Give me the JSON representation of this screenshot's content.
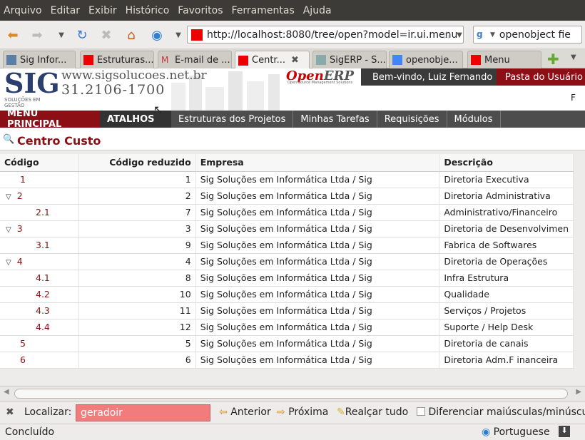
{
  "menubar": [
    "Arquivo",
    "Editar",
    "Exibir",
    "Histórico",
    "Favoritos",
    "Ferramentas",
    "Ajuda"
  ],
  "url": "http://localhost:8080/tree/open?model=ir.ui.menu",
  "search": "openobject fie",
  "tabs": [
    "Sig Infor...",
    "Estruturas...",
    "E-mail de ...",
    "Centr...",
    "SigERP - S...",
    "openobje...",
    "Menu"
  ],
  "header": {
    "site": "www.sigsolucoes.net.br",
    "phone": "31.2106-1700",
    "logo_big": "SIG",
    "logo_small": "SOLUÇÕES EM GESTÃO",
    "oerp_open": "Open",
    "oerp_erp": "ERP",
    "oerp_sub": "Open Source Management Solutions",
    "welcome": "Bem-vindo, Luiz Fernando",
    "user_panel": "Pasta do Usuário",
    "right_char": "F"
  },
  "menu": {
    "main": "MENU PRINCIPAL",
    "shortcuts": "ATALHOS",
    "items": [
      "Estruturas dos Projetos",
      "Minhas Tarefas",
      "Requisições",
      "Módulos"
    ]
  },
  "page_title": "Centro Custo",
  "table": {
    "headers": [
      "Código",
      "Código reduzido",
      "Empresa",
      "Descrição"
    ],
    "rows": [
      {
        "code": "1",
        "red": "1",
        "emp": "Sig Soluções em Informática Ltda / Sig",
        "desc": "Diretoria Executiva",
        "exp": false,
        "ind": 1
      },
      {
        "code": "2",
        "red": "2",
        "emp": "Sig Soluções em Informática Ltda / Sig",
        "desc": "Diretoria Administrativa",
        "exp": true,
        "ind": 1
      },
      {
        "code": "2.1",
        "red": "7",
        "emp": "Sig Soluções em Informática Ltda / Sig",
        "desc": "Administrativo/Financeiro",
        "exp": false,
        "ind": 2
      },
      {
        "code": "3",
        "red": "3",
        "emp": "Sig Soluções em Informática Ltda / Sig",
        "desc": "Diretoria de Desenvolvimen",
        "exp": true,
        "ind": 1
      },
      {
        "code": "3.1",
        "red": "9",
        "emp": "Sig Soluções em Informática Ltda / Sig",
        "desc": "Fabrica de Softwares",
        "exp": false,
        "ind": 2
      },
      {
        "code": "4",
        "red": "4",
        "emp": "Sig Soluções em Informática Ltda / Sig",
        "desc": "Diretoria de Operações",
        "exp": true,
        "ind": 1
      },
      {
        "code": "4.1",
        "red": "8",
        "emp": "Sig Soluções em Informática Ltda / Sig",
        "desc": "Infra Estrutura",
        "exp": false,
        "ind": 2
      },
      {
        "code": "4.2",
        "red": "10",
        "emp": "Sig Soluções em Informática Ltda / Sig",
        "desc": "Qualidade",
        "exp": false,
        "ind": 2
      },
      {
        "code": "4.3",
        "red": "11",
        "emp": "Sig Soluções em Informática Ltda / Sig",
        "desc": "Serviços / Projetos",
        "exp": false,
        "ind": 2
      },
      {
        "code": "4.4",
        "red": "12",
        "emp": "Sig Soluções em Informática Ltda / Sig",
        "desc": "Suporte / Help Desk",
        "exp": false,
        "ind": 2
      },
      {
        "code": "5",
        "red": "5",
        "emp": "Sig Soluções em Informática Ltda / Sig",
        "desc": "Diretoria de canais",
        "exp": false,
        "ind": 1
      },
      {
        "code": "6",
        "red": "6",
        "emp": "Sig Soluções em Informática Ltda / Sig",
        "desc": "Diretoria Adm.F inanceira",
        "exp": false,
        "ind": 1
      }
    ]
  },
  "findbar": {
    "label": "Localizar:",
    "value": "geradoir",
    "prev": "Anterior",
    "next": "Próxima",
    "highlight": "Realçar tudo",
    "match_case": "Diferenciar maiúsculas/minúsculas"
  },
  "status": {
    "text": "Concluído",
    "lang": "Portuguese"
  },
  "colors": {
    "brand": "#8c0f15",
    "find_error": "#f27b7b"
  }
}
